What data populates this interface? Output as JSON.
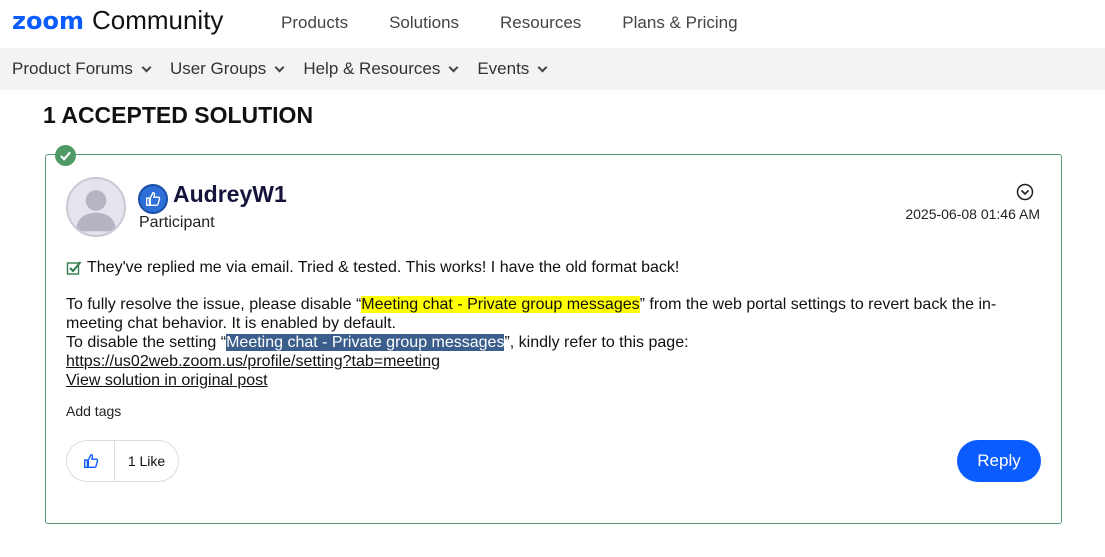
{
  "header": {
    "logo_brand": "zoom",
    "logo_suffix": "Community",
    "nav": [
      "Products",
      "Solutions",
      "Resources",
      "Plans & Pricing"
    ]
  },
  "subnav": {
    "items": [
      "Product Forums",
      "User Groups",
      "Help & Resources",
      "Events"
    ]
  },
  "section_title": "1 ACCEPTED SOLUTION",
  "post": {
    "author": "AudreyW1",
    "role": "Participant",
    "timestamp": "2025-06-08 01:46 AM",
    "quote": "They've replied me via email. Tried & tested. This works! I have the old format back!",
    "para1_before": "To fully resolve the issue, please disable “",
    "para1_highlight": "Meeting chat - Private group messages",
    "para1_after": "” from the web portal settings to revert back the in-meeting chat behavior. It is enabled by default.",
    "para2_before": "To disable the setting “",
    "para2_highlight": "Meeting chat - Private group messages",
    "para2_after": "”, kindly refer to this page:",
    "link_url": "https://us02web.zoom.us/profile/setting?tab=meeting ",
    "view_solution": "View solution in original post",
    "add_tags": "Add tags",
    "like_count": "1 Like",
    "reply_label": "Reply"
  },
  "colors": {
    "brand_blue": "#0b5cff",
    "accepted_border": "#5a9a72",
    "check_green": "#4f9a67",
    "highlight_yellow": "#ffff00",
    "highlight_blue": "#3b5e8c"
  },
  "icons": {
    "check_badge": "check-circle-icon",
    "rank": "thumbs-up-rank-icon",
    "options": "chevron-circle-down-icon",
    "quote_check": "checkbox-icon",
    "like": "thumbs-up-icon",
    "nav_caret": "chevron-down-icon"
  }
}
